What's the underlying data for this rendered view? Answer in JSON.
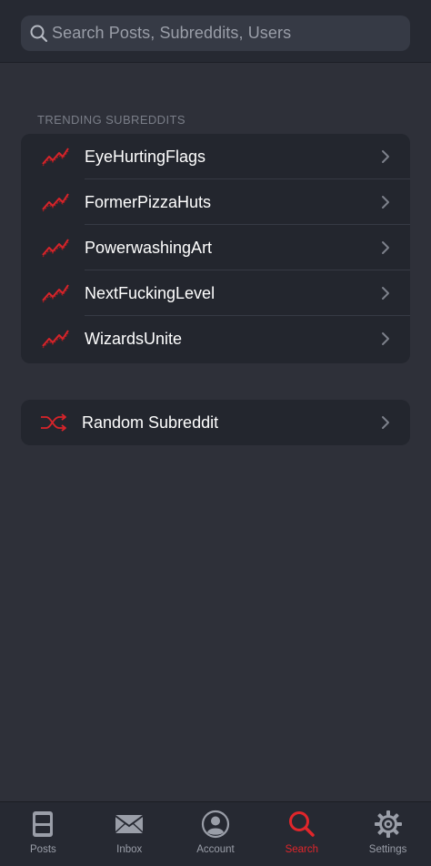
{
  "search": {
    "placeholder": "Search Posts, Subreddits, Users"
  },
  "trending": {
    "header": "TRENDING SUBREDDITS",
    "items": [
      {
        "label": "EyeHurtingFlags"
      },
      {
        "label": "FormerPizzaHuts"
      },
      {
        "label": "PowerwashingArt"
      },
      {
        "label": "NextFuckingLevel"
      },
      {
        "label": "WizardsUnite"
      }
    ]
  },
  "random": {
    "label": "Random Subreddit"
  },
  "tabs": [
    {
      "label": "Posts",
      "icon": "posts-icon"
    },
    {
      "label": "Inbox",
      "icon": "envelope-icon"
    },
    {
      "label": "Account",
      "icon": "account-icon"
    },
    {
      "label": "Search",
      "icon": "search-icon",
      "active": true
    },
    {
      "label": "Settings",
      "icon": "gear-icon"
    }
  ],
  "colors": {
    "accent": "#e0262b",
    "background": "#2e3039",
    "card": "#23262e",
    "header": "#262932",
    "muted": "#9a9ea8"
  }
}
